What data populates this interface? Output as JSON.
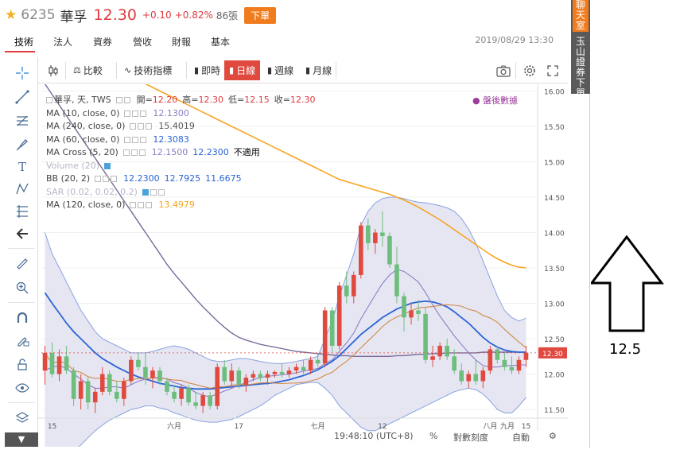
{
  "header": {
    "code": "6235",
    "name": "華孚",
    "price": "12.30",
    "change": "+0.10",
    "change_pct": "+0.82%",
    "volume": "86張",
    "order_label": "下單"
  },
  "tabs": [
    "技術",
    "法人",
    "資券",
    "營收",
    "財報",
    "基本"
  ],
  "datetime": "2019/08/29 13:30",
  "chart_toolbar": {
    "compare": "比較",
    "indicators": "技術指標",
    "intraday": "即時",
    "daily": "日線",
    "weekly": "週線",
    "monthly": "月線"
  },
  "legend": {
    "title": "華孚, 天, TWS",
    "ohlc": {
      "open_label": "開=",
      "open": "12.20",
      "high_label": "高=",
      "high": "12.30",
      "low_label": "低=",
      "low": "12.15",
      "close_label": "收=",
      "close": "12.30"
    },
    "after_hours": "盤後數據",
    "ma10": {
      "name": "MA (10, close, 0)",
      "value": "12.1300"
    },
    "ma240": {
      "name": "MA (240, close, 0)",
      "value": "15.4019"
    },
    "ma60": {
      "name": "MA (60, close, 0)",
      "value": "12.3083"
    },
    "macross": {
      "name": "MA Cross (5, 20)",
      "v1": "12.1500",
      "v2": "12.2300",
      "note": "不適用"
    },
    "volume": {
      "name": "Volume (20)"
    },
    "bb": {
      "name": "BB (20, 2)",
      "v1": "12.2300",
      "v2": "12.7925",
      "v3": "11.6675"
    },
    "sar": {
      "name": "SAR (0.02, 0.02, 0.2)"
    },
    "ma120": {
      "name": "MA (120, close, 0)",
      "value": "13.4979"
    }
  },
  "status": {
    "time": "19:48:10 (UTC+8)",
    "percent": "%",
    "log_scale": "對數刻度",
    "auto": "自動"
  },
  "right_panel": {
    "tab1": "聊天室",
    "tab2": "玉山證券下單"
  },
  "annotation": {
    "value": "12.5"
  },
  "colors": {
    "up": "#e0493e",
    "down": "#6dbd7c",
    "ma10": "#8c7fc5",
    "ma60": "#2b64d6",
    "ma120": "#f5a623",
    "ma240": "#7a6a9a",
    "bb_fill": "#e6e6f2",
    "bb_line": "#8aa2e0",
    "accent": "#f07c1e"
  },
  "chart_data": {
    "type": "candlestick",
    "y_ticks": [
      "16.00",
      "15.50",
      "15.00",
      "14.50",
      "14.00",
      "13.50",
      "13.00",
      "12.50",
      "12.00",
      "11.50"
    ],
    "ylim": [
      11.4,
      16.05
    ],
    "x_ticks": [
      "15",
      "六月",
      "17",
      "七月",
      "12",
      "八月",
      "15",
      "九月"
    ],
    "last_price_label": "12.30",
    "candles": [
      {
        "o": 12.05,
        "h": 12.4,
        "l": 11.85,
        "c": 12.3
      },
      {
        "o": 12.3,
        "h": 12.45,
        "l": 11.95,
        "c": 12.0
      },
      {
        "o": 12.0,
        "h": 12.35,
        "l": 11.9,
        "c": 12.25
      },
      {
        "o": 12.25,
        "h": 12.4,
        "l": 12.0,
        "c": 12.05
      },
      {
        "o": 12.05,
        "h": 12.1,
        "l": 11.55,
        "c": 11.65
      },
      {
        "o": 11.65,
        "h": 12.0,
        "l": 11.5,
        "c": 11.9
      },
      {
        "o": 11.9,
        "h": 11.95,
        "l": 11.5,
        "c": 11.6
      },
      {
        "o": 11.6,
        "h": 11.8,
        "l": 11.45,
        "c": 11.75
      },
      {
        "o": 11.75,
        "h": 12.1,
        "l": 11.7,
        "c": 12.0
      },
      {
        "o": 12.0,
        "h": 12.05,
        "l": 11.7,
        "c": 11.75
      },
      {
        "o": 11.75,
        "h": 11.9,
        "l": 11.6,
        "c": 11.65
      },
      {
        "o": 11.65,
        "h": 11.95,
        "l": 11.55,
        "c": 11.9
      },
      {
        "o": 11.9,
        "h": 12.25,
        "l": 11.85,
        "c": 12.2
      },
      {
        "o": 12.2,
        "h": 12.3,
        "l": 12.05,
        "c": 12.1
      },
      {
        "o": 12.1,
        "h": 12.3,
        "l": 11.85,
        "c": 11.95
      },
      {
        "o": 11.95,
        "h": 12.1,
        "l": 11.8,
        "c": 12.05
      },
      {
        "o": 12.05,
        "h": 12.1,
        "l": 11.85,
        "c": 11.9
      },
      {
        "o": 11.9,
        "h": 11.95,
        "l": 11.7,
        "c": 11.75
      },
      {
        "o": 11.75,
        "h": 11.85,
        "l": 11.6,
        "c": 11.65
      },
      {
        "o": 11.65,
        "h": 11.85,
        "l": 11.55,
        "c": 11.8
      },
      {
        "o": 11.8,
        "h": 11.85,
        "l": 11.55,
        "c": 11.6
      },
      {
        "o": 11.6,
        "h": 11.75,
        "l": 11.5,
        "c": 11.55
      },
      {
        "o": 11.55,
        "h": 11.75,
        "l": 11.45,
        "c": 11.7
      },
      {
        "o": 11.7,
        "h": 11.75,
        "l": 11.5,
        "c": 11.55
      },
      {
        "o": 11.55,
        "h": 12.15,
        "l": 11.5,
        "c": 12.1
      },
      {
        "o": 12.1,
        "h": 12.2,
        "l": 11.85,
        "c": 11.9
      },
      {
        "o": 11.9,
        "h": 12.15,
        "l": 11.8,
        "c": 12.05
      },
      {
        "o": 12.05,
        "h": 12.1,
        "l": 11.8,
        "c": 11.85
      },
      {
        "o": 11.85,
        "h": 12.0,
        "l": 11.75,
        "c": 11.95
      },
      {
        "o": 11.95,
        "h": 12.05,
        "l": 11.9,
        "c": 12.0
      },
      {
        "o": 12.0,
        "h": 12.05,
        "l": 11.9,
        "c": 11.95
      },
      {
        "o": 11.95,
        "h": 12.05,
        "l": 11.85,
        "c": 12.0
      },
      {
        "o": 12.0,
        "h": 12.05,
        "l": 11.95,
        "c": 12.03
      },
      {
        "o": 12.03,
        "h": 12.15,
        "l": 11.95,
        "c": 12.0
      },
      {
        "o": 12.0,
        "h": 12.1,
        "l": 11.95,
        "c": 12.05
      },
      {
        "o": 12.05,
        "h": 12.15,
        "l": 12.0,
        "c": 12.1
      },
      {
        "o": 12.1,
        "h": 12.2,
        "l": 12.0,
        "c": 12.05
      },
      {
        "o": 12.05,
        "h": 12.25,
        "l": 12.0,
        "c": 12.2
      },
      {
        "o": 12.2,
        "h": 12.3,
        "l": 12.1,
        "c": 12.15
      },
      {
        "o": 12.15,
        "h": 12.95,
        "l": 12.1,
        "c": 12.9
      },
      {
        "o": 12.9,
        "h": 12.95,
        "l": 12.3,
        "c": 12.4
      },
      {
        "o": 12.4,
        "h": 13.3,
        "l": 12.35,
        "c": 13.25
      },
      {
        "o": 13.25,
        "h": 13.45,
        "l": 13.0,
        "c": 13.1
      },
      {
        "o": 13.1,
        "h": 13.45,
        "l": 13.0,
        "c": 13.4
      },
      {
        "o": 13.4,
        "h": 14.15,
        "l": 13.35,
        "c": 14.1
      },
      {
        "o": 14.1,
        "h": 14.2,
        "l": 13.75,
        "c": 13.85
      },
      {
        "o": 13.85,
        "h": 14.05,
        "l": 13.7,
        "c": 14.0
      },
      {
        "o": 14.0,
        "h": 14.3,
        "l": 13.8,
        "c": 13.95
      },
      {
        "o": 13.95,
        "h": 14.0,
        "l": 13.5,
        "c": 13.55
      },
      {
        "o": 13.55,
        "h": 13.8,
        "l": 13.0,
        "c": 13.1
      },
      {
        "o": 13.1,
        "h": 13.15,
        "l": 12.6,
        "c": 12.8
      },
      {
        "o": 12.8,
        "h": 13.0,
        "l": 12.7,
        "c": 12.9
      },
      {
        "o": 12.9,
        "h": 13.05,
        "l": 12.75,
        "c": 12.85
      },
      {
        "o": 12.85,
        "h": 12.95,
        "l": 12.15,
        "c": 12.2
      },
      {
        "o": 12.2,
        "h": 12.4,
        "l": 12.1,
        "c": 12.25
      },
      {
        "o": 12.25,
        "h": 12.45,
        "l": 12.2,
        "c": 12.4
      },
      {
        "o": 12.4,
        "h": 12.5,
        "l": 12.2,
        "c": 12.25
      },
      {
        "o": 12.25,
        "h": 12.35,
        "l": 12.0,
        "c": 12.05
      },
      {
        "o": 12.05,
        "h": 12.15,
        "l": 11.85,
        "c": 11.9
      },
      {
        "o": 11.9,
        "h": 12.05,
        "l": 11.8,
        "c": 12.0
      },
      {
        "o": 12.0,
        "h": 12.2,
        "l": 11.85,
        "c": 11.9
      },
      {
        "o": 11.9,
        "h": 12.1,
        "l": 11.8,
        "c": 12.05
      },
      {
        "o": 12.05,
        "h": 12.4,
        "l": 12.0,
        "c": 12.35
      },
      {
        "o": 12.35,
        "h": 12.4,
        "l": 12.15,
        "c": 12.2
      },
      {
        "o": 12.2,
        "h": 12.3,
        "l": 12.05,
        "c": 12.1
      },
      {
        "o": 12.1,
        "h": 12.25,
        "l": 12.0,
        "c": 12.05
      },
      {
        "o": 12.05,
        "h": 12.25,
        "l": 12.0,
        "c": 12.2
      },
      {
        "o": 12.2,
        "h": 12.4,
        "l": 12.1,
        "c": 12.3
      }
    ],
    "ma10": [
      12.05,
      12.1,
      12.12,
      12.08,
      12.0,
      11.93,
      11.85,
      11.8,
      11.8,
      11.82,
      11.82,
      11.8,
      11.85,
      11.9,
      11.93,
      11.95,
      11.95,
      11.93,
      11.88,
      11.85,
      11.8,
      11.74,
      11.7,
      11.68,
      11.72,
      11.76,
      11.8,
      11.84,
      11.88,
      11.92,
      11.95,
      11.97,
      11.98,
      11.99,
      12.0,
      12.02,
      12.04,
      12.06,
      12.08,
      12.15,
      12.2,
      12.32,
      12.44,
      12.58,
      12.78,
      12.95,
      13.12,
      13.28,
      13.4,
      13.48,
      13.45,
      13.38,
      13.3,
      13.15,
      12.98,
      12.82,
      12.68,
      12.54,
      12.42,
      12.3,
      12.2,
      12.12,
      12.1,
      12.1,
      12.12,
      12.12,
      12.13,
      12.13
    ],
    "ma60": [
      13.15,
      13.0,
      12.86,
      12.72,
      12.6,
      12.5,
      12.4,
      12.3,
      12.22,
      12.16,
      12.1,
      12.05,
      12.0,
      11.96,
      11.93,
      11.9,
      11.87,
      11.85,
      11.83,
      11.81,
      11.8,
      11.79,
      11.79,
      11.79,
      11.8,
      11.81,
      11.82,
      11.83,
      11.84,
      11.85,
      11.86,
      11.87,
      11.88,
      11.9,
      11.92,
      11.95,
      11.98,
      12.02,
      12.06,
      12.12,
      12.18,
      12.26,
      12.36,
      12.46,
      12.56,
      12.64,
      12.72,
      12.8,
      12.86,
      12.92,
      12.96,
      13.0,
      13.02,
      13.03,
      13.02,
      12.99,
      12.95,
      12.88,
      12.8,
      12.72,
      12.62,
      12.52,
      12.44,
      12.38,
      12.34,
      12.32,
      12.31,
      12.31
    ],
    "ma120": [
      16.1,
      15.95,
      15.8,
      15.65,
      15.5,
      15.35,
      15.2,
      15.05,
      14.9,
      14.75,
      14.6,
      14.45,
      14.3,
      14.15,
      14.0,
      13.85,
      13.7,
      13.55,
      13.42,
      13.3,
      13.18,
      13.06,
      12.95,
      12.85,
      12.75,
      12.66,
      12.58,
      12.52,
      12.48,
      12.45,
      12.42,
      12.4,
      12.38,
      12.36,
      12.34,
      12.32,
      12.31,
      12.3,
      12.29,
      12.28,
      12.27,
      12.26,
      12.26,
      12.25,
      12.25,
      12.25,
      12.25,
      12.25,
      12.25,
      12.26,
      12.26,
      12.27,
      12.28,
      12.28,
      12.29,
      12.29,
      12.3,
      12.3,
      12.3,
      12.3,
      12.3,
      12.31,
      12.31,
      12.31,
      12.31,
      12.31,
      12.31,
      12.31
    ],
    "ma240": [
      16.8,
      16.75,
      16.7,
      16.65,
      16.6,
      16.55,
      16.5,
      16.45,
      16.4,
      16.35,
      16.3,
      16.25,
      16.2,
      16.15,
      16.1,
      16.05,
      16.0,
      15.95,
      15.9,
      15.85,
      15.8,
      15.75,
      15.7,
      15.65,
      15.6,
      15.55,
      15.5,
      15.45,
      15.4,
      15.35,
      15.3,
      15.25,
      15.2,
      15.15,
      15.1,
      15.05,
      15.0,
      14.95,
      14.9,
      14.85,
      14.8,
      14.75,
      14.72,
      14.69,
      14.66,
      14.63,
      14.6,
      14.57,
      14.54,
      14.5,
      14.46,
      14.41,
      14.36,
      14.3,
      14.24,
      14.18,
      14.11,
      14.04,
      13.97,
      13.9,
      13.83,
      13.76,
      13.69,
      13.63,
      13.58,
      13.54,
      13.51,
      13.5
    ],
    "bb_upper": [
      14.0,
      13.7,
      13.5,
      13.3,
      13.1,
      12.9,
      12.75,
      12.6,
      12.5,
      12.45,
      12.4,
      12.35,
      12.3,
      12.3,
      12.3,
      12.32,
      12.35,
      12.38,
      12.4,
      12.38,
      12.35,
      12.3,
      12.25,
      12.2,
      12.18,
      12.18,
      12.2,
      12.22,
      12.22,
      12.2,
      12.18,
      12.16,
      12.15,
      12.15,
      12.16,
      12.18,
      12.2,
      12.22,
      12.25,
      12.5,
      12.75,
      13.1,
      13.4,
      13.7,
      14.1,
      14.3,
      14.42,
      14.48,
      14.5,
      14.5,
      14.48,
      14.45,
      14.43,
      14.42,
      14.4,
      14.38,
      14.35,
      14.3,
      14.2,
      14.05,
      13.85,
      13.6,
      13.35,
      13.1,
      12.9,
      12.8,
      12.75,
      12.79
    ],
    "bb_lower": [
      10.5,
      10.6,
      10.7,
      10.8,
      10.9,
      11.0,
      11.1,
      11.2,
      11.28,
      11.35,
      11.4,
      11.45,
      11.5,
      11.52,
      11.55,
      11.55,
      11.52,
      11.5,
      11.45,
      11.42,
      11.38,
      11.35,
      11.33,
      11.32,
      11.32,
      11.34,
      11.36,
      11.4,
      11.45,
      11.5,
      11.55,
      11.62,
      11.7,
      11.75,
      11.8,
      11.85,
      11.87,
      11.88,
      11.88,
      11.8,
      11.7,
      11.55,
      11.45,
      11.35,
      11.25,
      11.2,
      11.2,
      11.25,
      11.3,
      11.35,
      11.4,
      11.45,
      11.5,
      11.55,
      11.6,
      11.65,
      11.7,
      11.75,
      11.78,
      11.8,
      11.78,
      11.72,
      11.62,
      11.5,
      11.45,
      11.45,
      11.55,
      11.67
    ]
  }
}
